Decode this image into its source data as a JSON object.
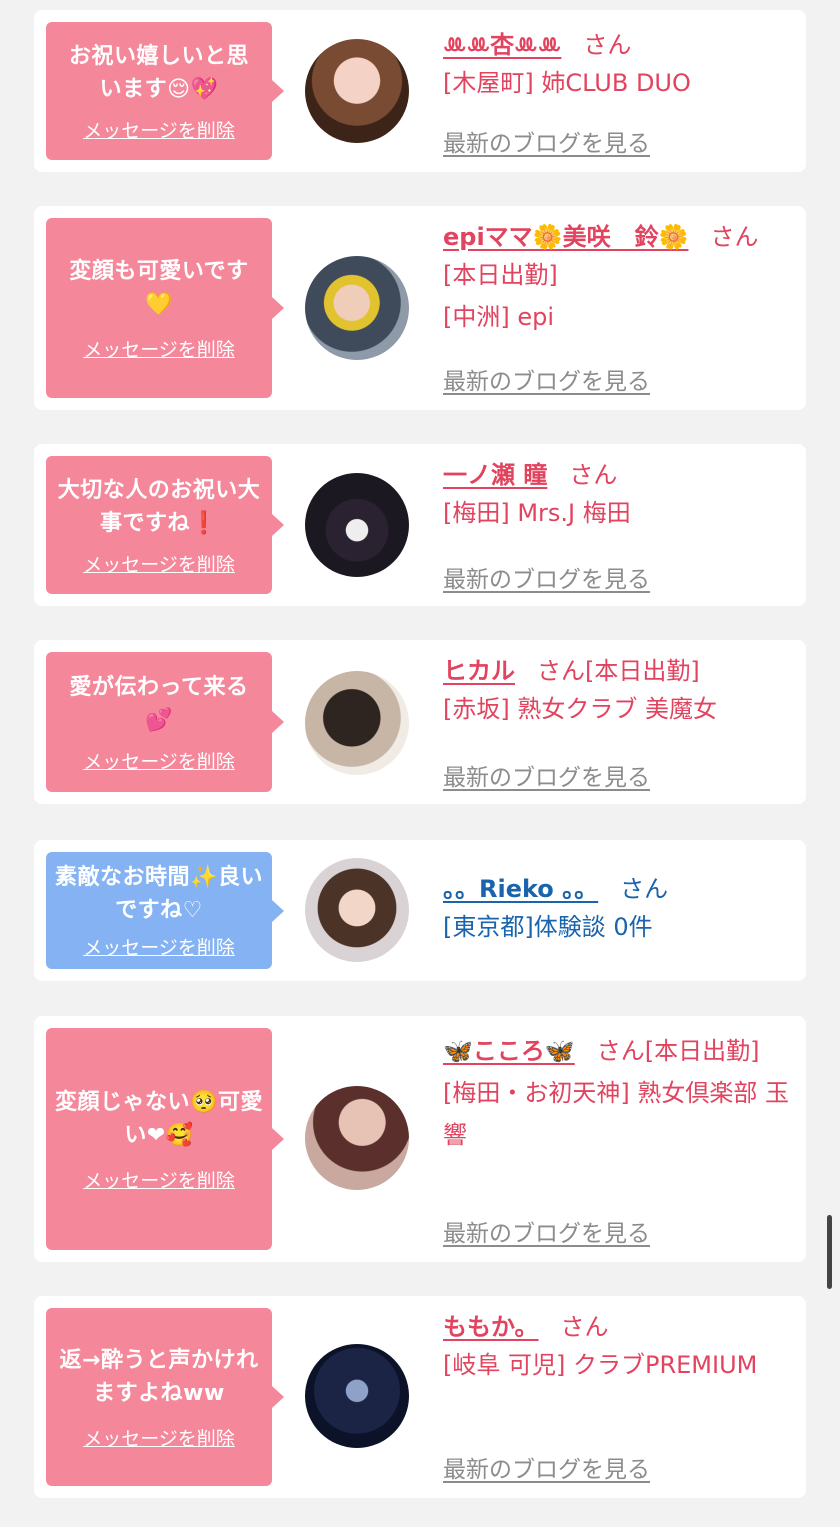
{
  "cards": [
    {
      "message": "お祝い嬉しいと思います😌💖",
      "delete_label": "メッセージを削除",
      "name": "ꔛꔛ杏ꔛꔛ",
      "suffix": "さん",
      "lines": [
        "[木屋町] 姉CLUB DUO"
      ],
      "blog_label": "最新のブログを見る",
      "theme": "pink"
    },
    {
      "message": "変顔も可愛いです💛",
      "delete_label": "メッセージを削除",
      "name": "epiママ🌼美咲　鈴🌼",
      "suffix": "さん",
      "lines": [
        "[本日出勤]",
        "[中洲] epi"
      ],
      "blog_label": "最新のブログを見る",
      "theme": "pink"
    },
    {
      "message": "大切な人のお祝い大事ですね❗",
      "delete_label": "メッセージを削除",
      "name": "一ノ瀬 瞳",
      "suffix": "さん",
      "lines": [
        "[梅田] Mrs.J 梅田"
      ],
      "blog_label": "最新のブログを見る",
      "theme": "pink"
    },
    {
      "message": "愛が伝わって来る💕",
      "delete_label": "メッセージを削除",
      "name": "ヒカル",
      "suffix": "さん[本日出勤]",
      "lines": [
        "[赤坂] 熟女クラブ 美魔女"
      ],
      "blog_label": "最新のブログを見る",
      "theme": "pink"
    },
    {
      "message": "素敵なお時間✨良いですね♡",
      "delete_label": "メッセージを削除",
      "name": "。。Rieko 。。",
      "suffix": "さん",
      "lines": [
        "[東京都]体験談 0件"
      ],
      "blog_label": "",
      "theme": "blue"
    },
    {
      "message": "変顔じゃない🥺可愛い❤🥰",
      "delete_label": "メッセージを削除",
      "name": "🦋こころ🦋",
      "suffix": "さん[本日出勤]",
      "lines": [
        "[梅田・お初天神] 熟女倶楽部 玉響"
      ],
      "blog_label": "最新のブログを見る",
      "theme": "pink"
    },
    {
      "message": "返→酔うと声かけれますよねww",
      "delete_label": "メッセージを削除",
      "name": "ももか。",
      "suffix": "さん",
      "lines": [
        "[岐阜 可児] クラブPREMIUM"
      ],
      "blog_label": "最新のブログを見る",
      "theme": "pink"
    }
  ]
}
